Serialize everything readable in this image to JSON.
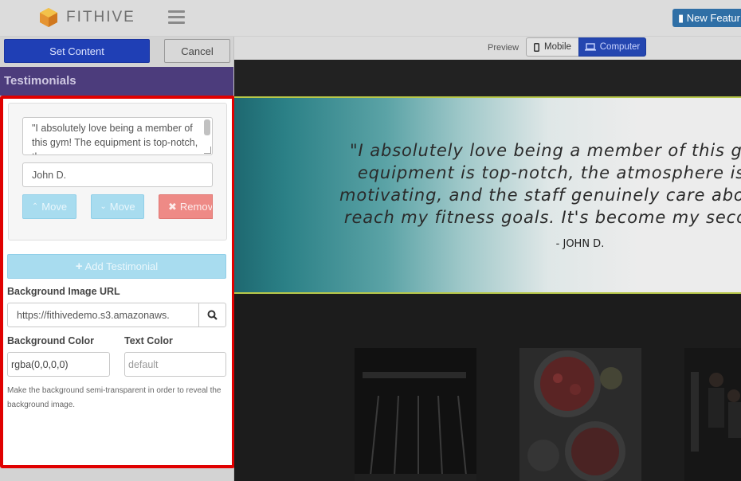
{
  "header": {
    "brand": "FITHIVE",
    "new_feature_label": "New Featur"
  },
  "sidebar": {
    "set_content_label": "Set Content",
    "cancel_label": "Cancel",
    "section_title": "Testimonials",
    "testimonial": {
      "text": "\"I absolutely love being a member of this gym! The equipment is top-notch, the",
      "name": "John D.",
      "move_up_label": "Move",
      "move_down_label": "Move",
      "remove_label": "Remov"
    },
    "add_label": "Add Testimonial",
    "bg_image_label": "Background Image URL",
    "bg_image_url": "https://fithivedemo.s3.amazonaws.",
    "bg_color_label": "Background Color",
    "bg_color_value": "rgba(0,0,0,0)",
    "text_color_label": "Text Color",
    "text_color_placeholder": "default",
    "hint": "Make the background semi-transparent in order to reveal the background image."
  },
  "preview_bar": {
    "label": "Preview",
    "mobile_label": "Mobile",
    "computer_label": "Computer",
    "active": "computer"
  },
  "preview": {
    "quote_lines": [
      "\"I absolutely love being a member of this gy",
      "equipment is top-notch, the atmosphere is",
      "motivating, and the staff genuinely care about",
      "reach my fitness goals. It's become my secon"
    ],
    "author": "- JOHN D."
  },
  "colors": {
    "primary": "#1f3fb5",
    "section_header": "#4c3c7c",
    "highlight_border": "#e00000",
    "info_button": "#a8dcef",
    "danger_button": "#ee8a86",
    "hero_teal": "#1e6870"
  }
}
